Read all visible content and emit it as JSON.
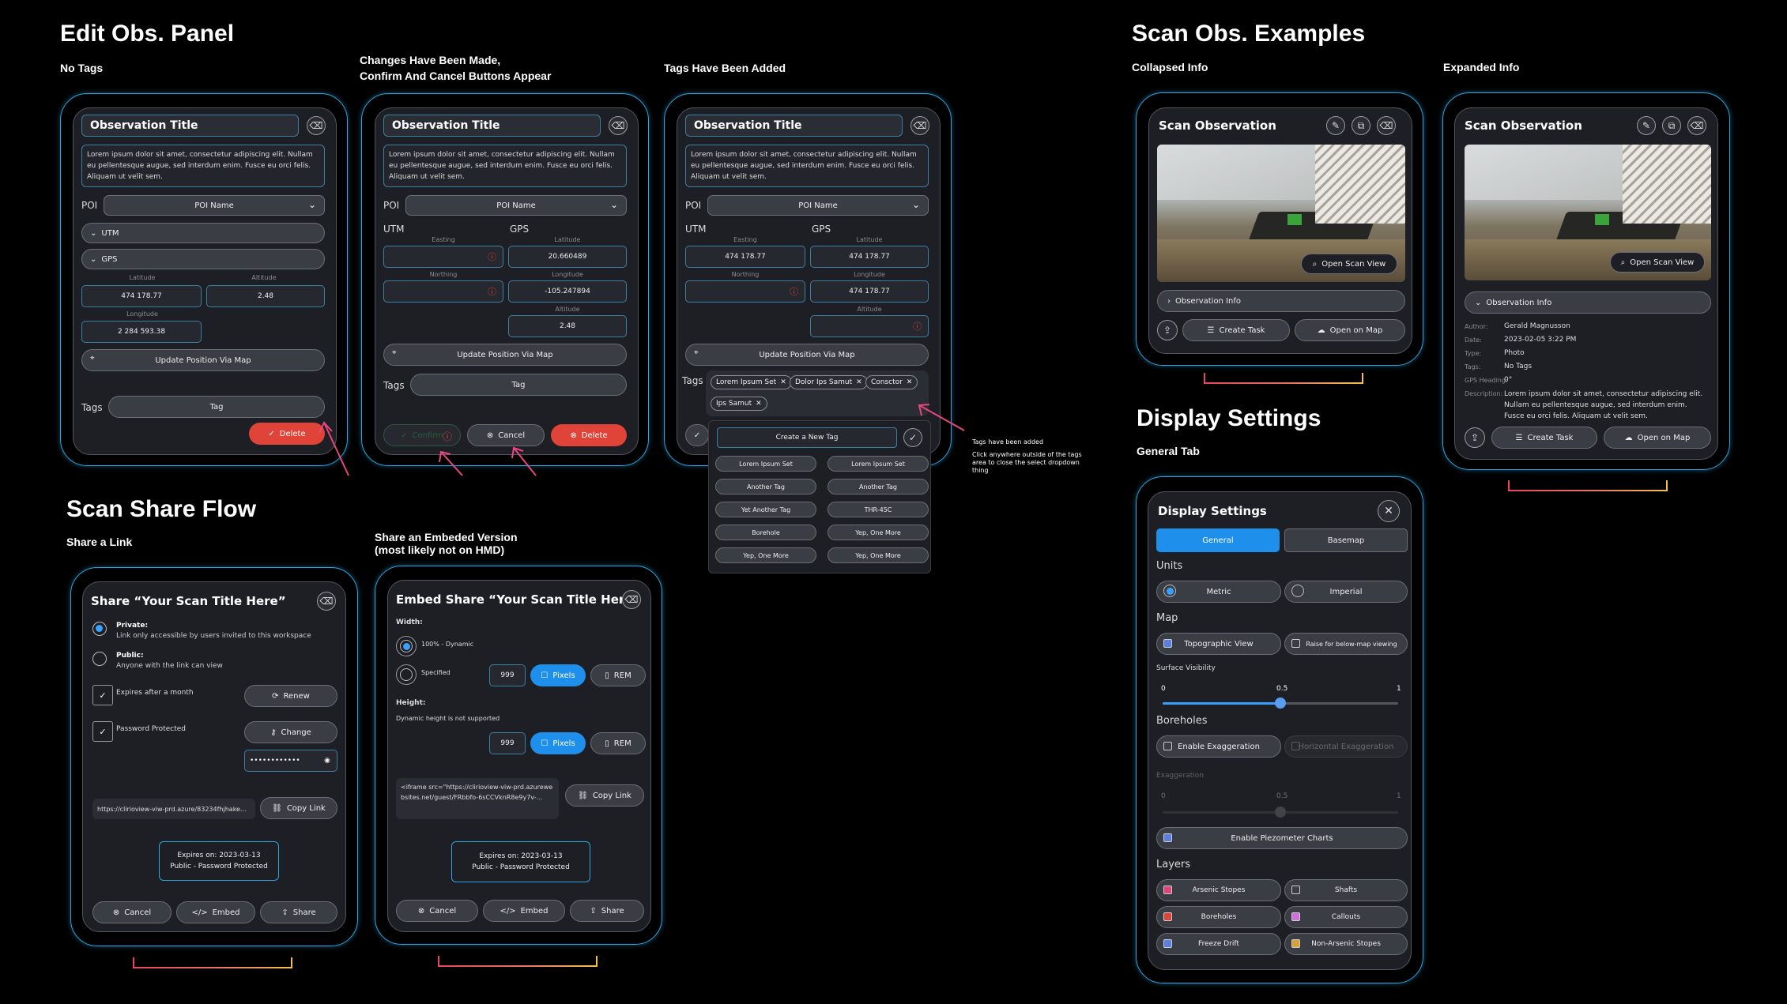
{
  "headings": {
    "edit": "Edit Obs. Panel",
    "scan_examples": "Scan Obs. Examples",
    "display": "Display Settings",
    "share_flow": "Scan Share Flow"
  },
  "subs": {
    "no_tags": "No Tags",
    "changes_1": "Changes Have Been Made,",
    "changes_2": "Confirm And Cancel Buttons Appear",
    "tags_added": "Tags Have Been Added",
    "collapsed": "Collapsed Info",
    "expanded": "Expanded Info",
    "general_tab": "General Tab",
    "share_link": "Share a Link",
    "embed_1": "Share an Embeded Version",
    "embed_2": "(most likely not on HMD)"
  },
  "obs": {
    "title": "Observation Title",
    "desc": "Lorem ipsum dolor sit amet, consectetur adipiscing elit. Nullam eu pellentesque augue, sed interdum enim. Fusce eu orci felis. Aliquam ut velit sem.",
    "poi": "POI",
    "poi_name": "POI Name",
    "utm": "UTM",
    "gps": "GPS",
    "latitude": "Latitude",
    "altitude": "Altitude",
    "longitude": "Longitude",
    "easting": "Easting",
    "northing": "Northing",
    "lat_val": "474 178.77",
    "alt_val": "2.48",
    "lon_val": "2 284 593.38",
    "lat2": "20.660489",
    "lon2": "-105.247894",
    "alt2": "2.48",
    "east3": "474 178.77",
    "lat3": "474 178.77",
    "lon3": "474 178.77",
    "update": "Update Position Via Map",
    "tags": "Tags",
    "tag": "Tag",
    "delete": "Delete",
    "confirm": "Confirm",
    "cancel": "Cancel"
  },
  "chips": [
    "Lorem Ipsum Set",
    "Dolor Ips Samut",
    "Consctor",
    "Ips Samut"
  ],
  "dropdown": {
    "create": "Create a New Tag",
    "items": [
      "Lorem Ipsum Set",
      "Lorem Ipsum Set",
      "Another Tag",
      "Another Tag",
      "Yet Another Tag",
      "THR-45C",
      "Borehole",
      "Yep, One More",
      "Yep, One More",
      "Yep, One More"
    ]
  },
  "annot": {
    "line1": "Tags have been added",
    "line2": "Click anywhere outside of the tags area to close the select dropdown thing"
  },
  "scan": {
    "title": "Scan Observation",
    "open_scan": "Open Scan View",
    "obs_info": "Observation Info",
    "create_task": "Create Task",
    "open_map": "Open on Map",
    "author_k": "Author:",
    "author_v": "Gerald Magnusson",
    "date_k": "Date:",
    "date_v": "2023-02-05 3:22 PM",
    "type_k": "Type:",
    "type_v": "Photo",
    "tags_k": "Tags:",
    "tags_v": "No Tags",
    "heading_k": "GPS Heading:",
    "heading_v": "0°",
    "desc_k": "Description:",
    "desc_v": "Lorem ipsum dolor sit amet, consectetur adipiscing elit. Nullam eu pellentesque augue, sed interdum enim. Fusce eu orci felis. Aliquam ut velit sem."
  },
  "display": {
    "title": "Display Settings",
    "general": "General",
    "basemap": "Basemap",
    "units": "Units",
    "metric": "Metric",
    "imperial": "Imperial",
    "map": "Map",
    "topo": "Topographic View",
    "raise": "Raise for below-map viewing",
    "surface": "Surface Visibility",
    "s0": "0",
    "s05": "0.5",
    "s1": "1",
    "surface_value": 0.5,
    "boreholes": "Boreholes",
    "enable_ex": "Enable Exaggeration",
    "enable_ex2": "Horizontal Exaggeration",
    "exag": "Exaggeration",
    "piezo": "Enable Piezometer Charts",
    "layers": "Layers",
    "layer_items": [
      "Arsenic Stopes",
      "Shafts",
      "Boreholes",
      "Callouts",
      "Freeze Drift",
      "Non-Arsenic Stopes"
    ],
    "layer_colors": [
      "#e0457a",
      "#9aa0a8",
      "#e04438",
      "#d46fe0",
      "#5a7fe0",
      "#d9a03a"
    ]
  },
  "share": {
    "title": "Share “Your Scan Title Here”",
    "private": "Private:",
    "private_d": "Link only accessible by users invited to this workspace",
    "public": "Public:",
    "public_d": "Anyone with the link can view",
    "expires": "Expires after a month",
    "renew": "Renew",
    "pw": "Password Protected",
    "change": "Change",
    "pw_val": "••••••••••••",
    "url": "https://clirioview-viw-prd.azure/83234fhjhake...",
    "copy": "Copy Link",
    "exp_on": "Expires on: 2023-03-13",
    "exp_type": "Public - Password Protected",
    "cancel": "Cancel",
    "embed": "Embed",
    "share_btn": "Share"
  },
  "embed": {
    "title": "Embed Share “Your Scan Title Here”",
    "width": "Width:",
    "dyn": "100% - Dynamic",
    "spec": "Specified",
    "num": "999",
    "pixels": "Pixels",
    "rem": "REM",
    "height": "Height:",
    "no_dyn": "Dynamic height is not supported",
    "code": "<iframe src=\"https://clirioview-viw-prd.azurewebsites.net/guest/FRbbfo-6sCCVknR8e9y7v-...",
    "copy": "Copy Link"
  }
}
